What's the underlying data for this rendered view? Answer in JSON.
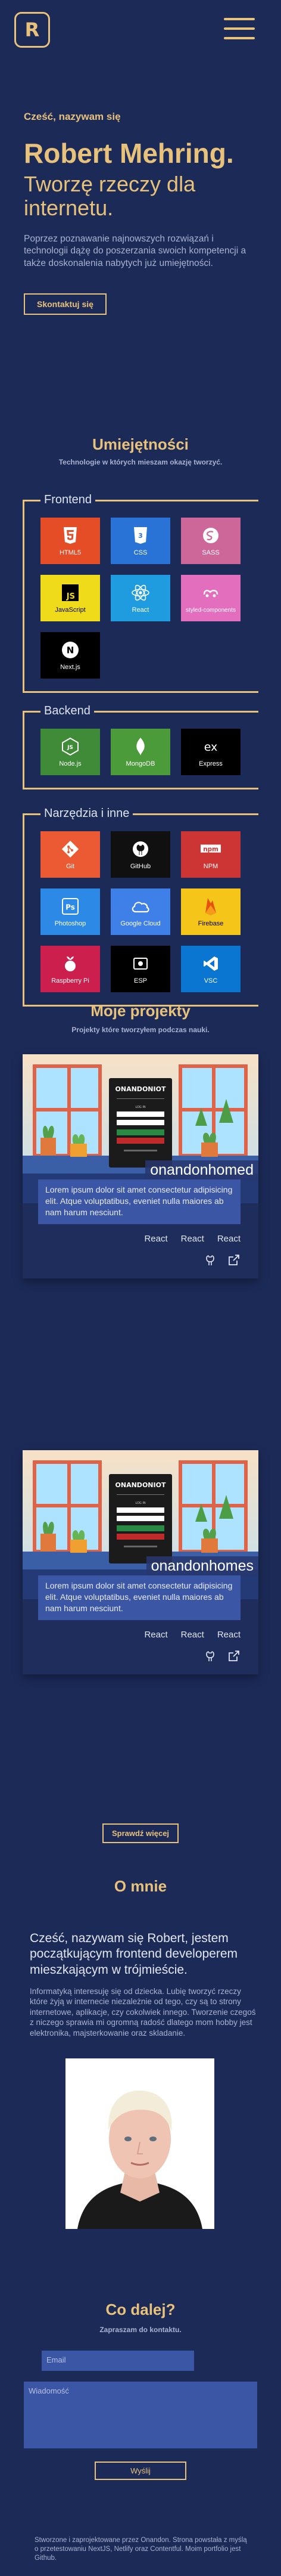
{
  "header": {
    "logo_letter": "R"
  },
  "hero": {
    "greeting": "Cześć, nazywam się",
    "name": "Robert Mehring.",
    "tagline": "Tworzę rzeczy dla internetu.",
    "description": "Poprzez poznawanie najnowszych rozwiązań i technologii dążę do poszerzania swoich kompetencji a także doskonalenia nabytych już umiejętności.",
    "cta": "Skontaktuj się"
  },
  "skills": {
    "title": "Umiejętności",
    "subtitle": "Technologie w których mieszam okazję tworzyć.",
    "groups": [
      {
        "label": "Frontend",
        "items": [
          {
            "name": "HTML5",
            "color": "#e44d26",
            "icon": "html5-icon"
          },
          {
            "name": "CSS",
            "color": "#2a73d6",
            "icon": "css3-icon"
          },
          {
            "name": "SASS",
            "color": "#cd6799",
            "icon": "sass-icon"
          },
          {
            "name": "JavaScript",
            "color": "#f0db1a",
            "icon": "javascript-icon"
          },
          {
            "name": "React",
            "color": "#1f9be0",
            "icon": "react-icon"
          },
          {
            "name": "styled-components",
            "color": "#e36ebd",
            "icon": "styled-components-icon"
          },
          {
            "name": "Next.js",
            "color": "#000000",
            "icon": "nextjs-icon"
          }
        ]
      },
      {
        "label": "Backend",
        "items": [
          {
            "name": "Node.js",
            "color": "#3f8b37",
            "icon": "nodejs-icon"
          },
          {
            "name": "MongoDB",
            "color": "#4b9b3b",
            "icon": "mongodb-icon"
          },
          {
            "name": "Express",
            "color": "#000000",
            "icon": "express-icon"
          }
        ]
      },
      {
        "label": "Narzędzia i inne",
        "items": [
          {
            "name": "Git",
            "color": "#ec5a33",
            "icon": "git-icon"
          },
          {
            "name": "GitHub",
            "color": "#101010",
            "icon": "github-icon"
          },
          {
            "name": "NPM",
            "color": "#cc3534",
            "icon": "npm-icon"
          },
          {
            "name": "Photoshop",
            "color": "#2c8ae6",
            "icon": "photoshop-icon"
          },
          {
            "name": "Google Cloud",
            "color": "#3f7fe8",
            "icon": "google-cloud-icon"
          },
          {
            "name": "Firebase",
            "color": "#f6c51a",
            "icon": "firebase-icon"
          },
          {
            "name": "Raspberry Pi",
            "color": "#cc1f4d",
            "icon": "raspberry-pi-icon"
          },
          {
            "name": "ESP",
            "color": "#000000",
            "icon": "esp-icon"
          },
          {
            "name": "VSC",
            "color": "#0a76d1",
            "icon": "vscode-icon"
          }
        ]
      }
    ]
  },
  "projects": {
    "title": "Moje projekty",
    "subtitle": "Projekty które tworzyłem podczas nauki.",
    "items": [
      {
        "name": "onandonhomed",
        "app_title": "ONANDONIOT",
        "description": "Lorem ipsum dolor sit amet consectetur adipisicing elit. Atque voluptatibus, eveniet nulla maiores ab nam harum nesciunt.",
        "tags": [
          "React",
          "React",
          "React"
        ]
      },
      {
        "name": "onandonhomes",
        "app_title": "ONANDONIOT",
        "description": "Lorem ipsum dolor sit amet consectetur adipisicing elit. Atque voluptatibus, eveniet nulla maiores ab nam harum nesciunt.",
        "tags": [
          "React",
          "React",
          "React"
        ]
      }
    ],
    "more": "Sprawdź więcej"
  },
  "about": {
    "title": "O mnie",
    "lead": "Cześć, nazywam się Robert, jestem początkującym frontend developerem mieszkającym w trójmieście.",
    "body": "Informatyką interesuję się od dziecka. Lubię tworzyć rzeczy które żyją w internecie niezależnie od tego, czy są to strony internetowe, aplikacje, czy cokolwiek innego. Tworzenie czegoś z niczego sprawia mi ogromną radość dlatego mom hobby jest elektronika, majsterkowanie oraz skladanie."
  },
  "contact": {
    "title": "Co dalej?",
    "subtitle": "Zapraszam do kontaktu.",
    "email_placeholder": "Email",
    "message_placeholder": "Wiadomość",
    "submit": "Wyślij"
  },
  "footer": {
    "text": "Stworzone i zaprojektowane przez Onandon. Strona powstała z myślą o przetestowaniu NextJS, Netlify oraz Contentful. Moim portfolio jest Github."
  },
  "colors": {
    "accent": "#e8c27a",
    "background": "#1c2a58",
    "card": "#3c56a6"
  }
}
